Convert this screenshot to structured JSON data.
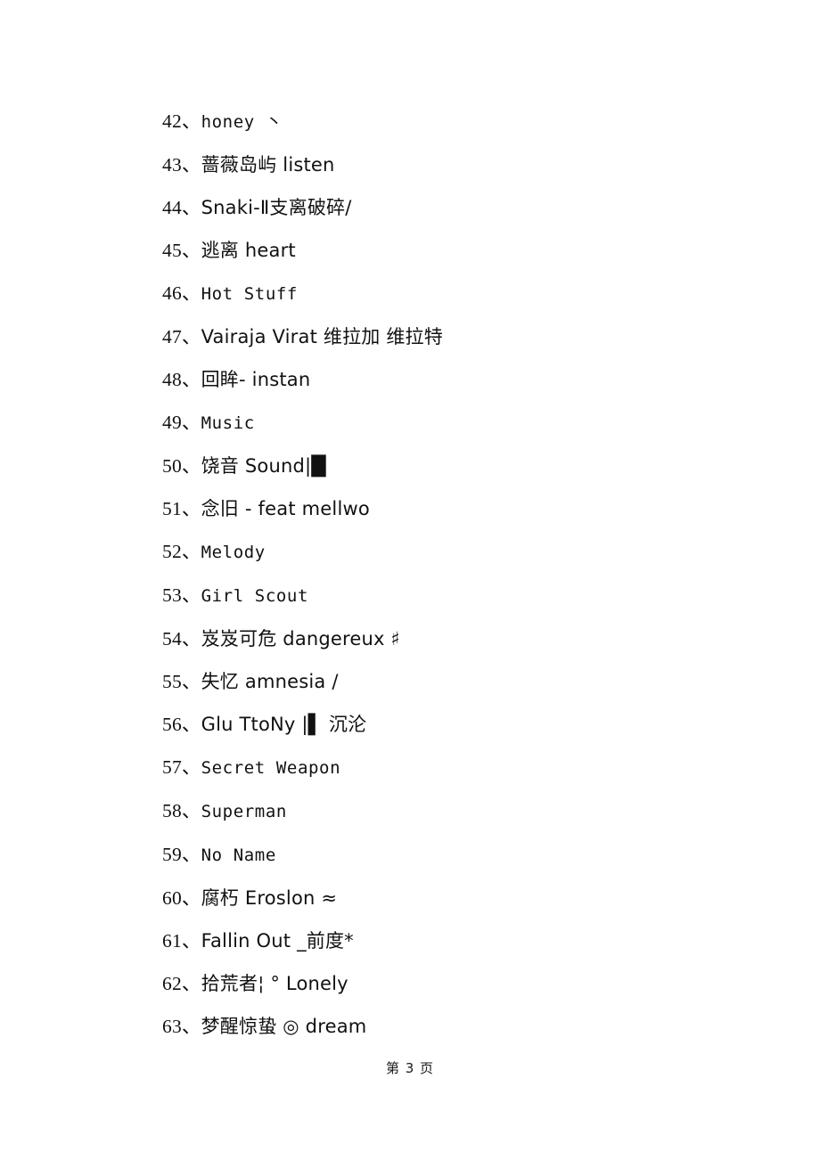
{
  "document": {
    "page_number": "3",
    "footer_text": "第 3 页",
    "lines": [
      {
        "index": "42、",
        "text": "honey 丶"
      },
      {
        "index": "43、",
        "text": "蔷薇岛屿 listen"
      },
      {
        "index": "44、",
        "text": "Snaki-Ⅱ支离破碎/"
      },
      {
        "index": "45、",
        "text": "逃离 heart"
      },
      {
        "index": "46、",
        "text": "Hot Stuff"
      },
      {
        "index": "47、",
        "text": "Vairaja Virat 维拉加 维拉特"
      },
      {
        "index": "48、",
        "text": "回眸- instan"
      },
      {
        "index": "49、",
        "text": "Music"
      },
      {
        "index": "50、",
        "text": "饶音 Sound|█"
      },
      {
        "index": "51、",
        "text": "念旧 - feat mellwo"
      },
      {
        "index": "52、",
        "text": "Melody"
      },
      {
        "index": "53、",
        "text": "Girl Scout"
      },
      {
        "index": "54、",
        "text": "岌岌可危 dangereux ♯"
      },
      {
        "index": "55、",
        "text": "失忆 amnesia /"
      },
      {
        "index": "56、",
        "text": "Glu TtoNy |▌ 沉沦"
      },
      {
        "index": "57、",
        "text": "Secret Weapon"
      },
      {
        "index": "58、",
        "text": "Superman"
      },
      {
        "index": "59、",
        "text": "No Name"
      },
      {
        "index": "60、",
        "text": "腐朽 Eroslon ≈"
      },
      {
        "index": "61、",
        "text": "Fallin Out _前度*"
      },
      {
        "index": "62、",
        "text": "拾荒者¦ ° Lonely"
      },
      {
        "index": "63、",
        "text": "梦醒惊蛰 ◎ dream"
      }
    ]
  }
}
